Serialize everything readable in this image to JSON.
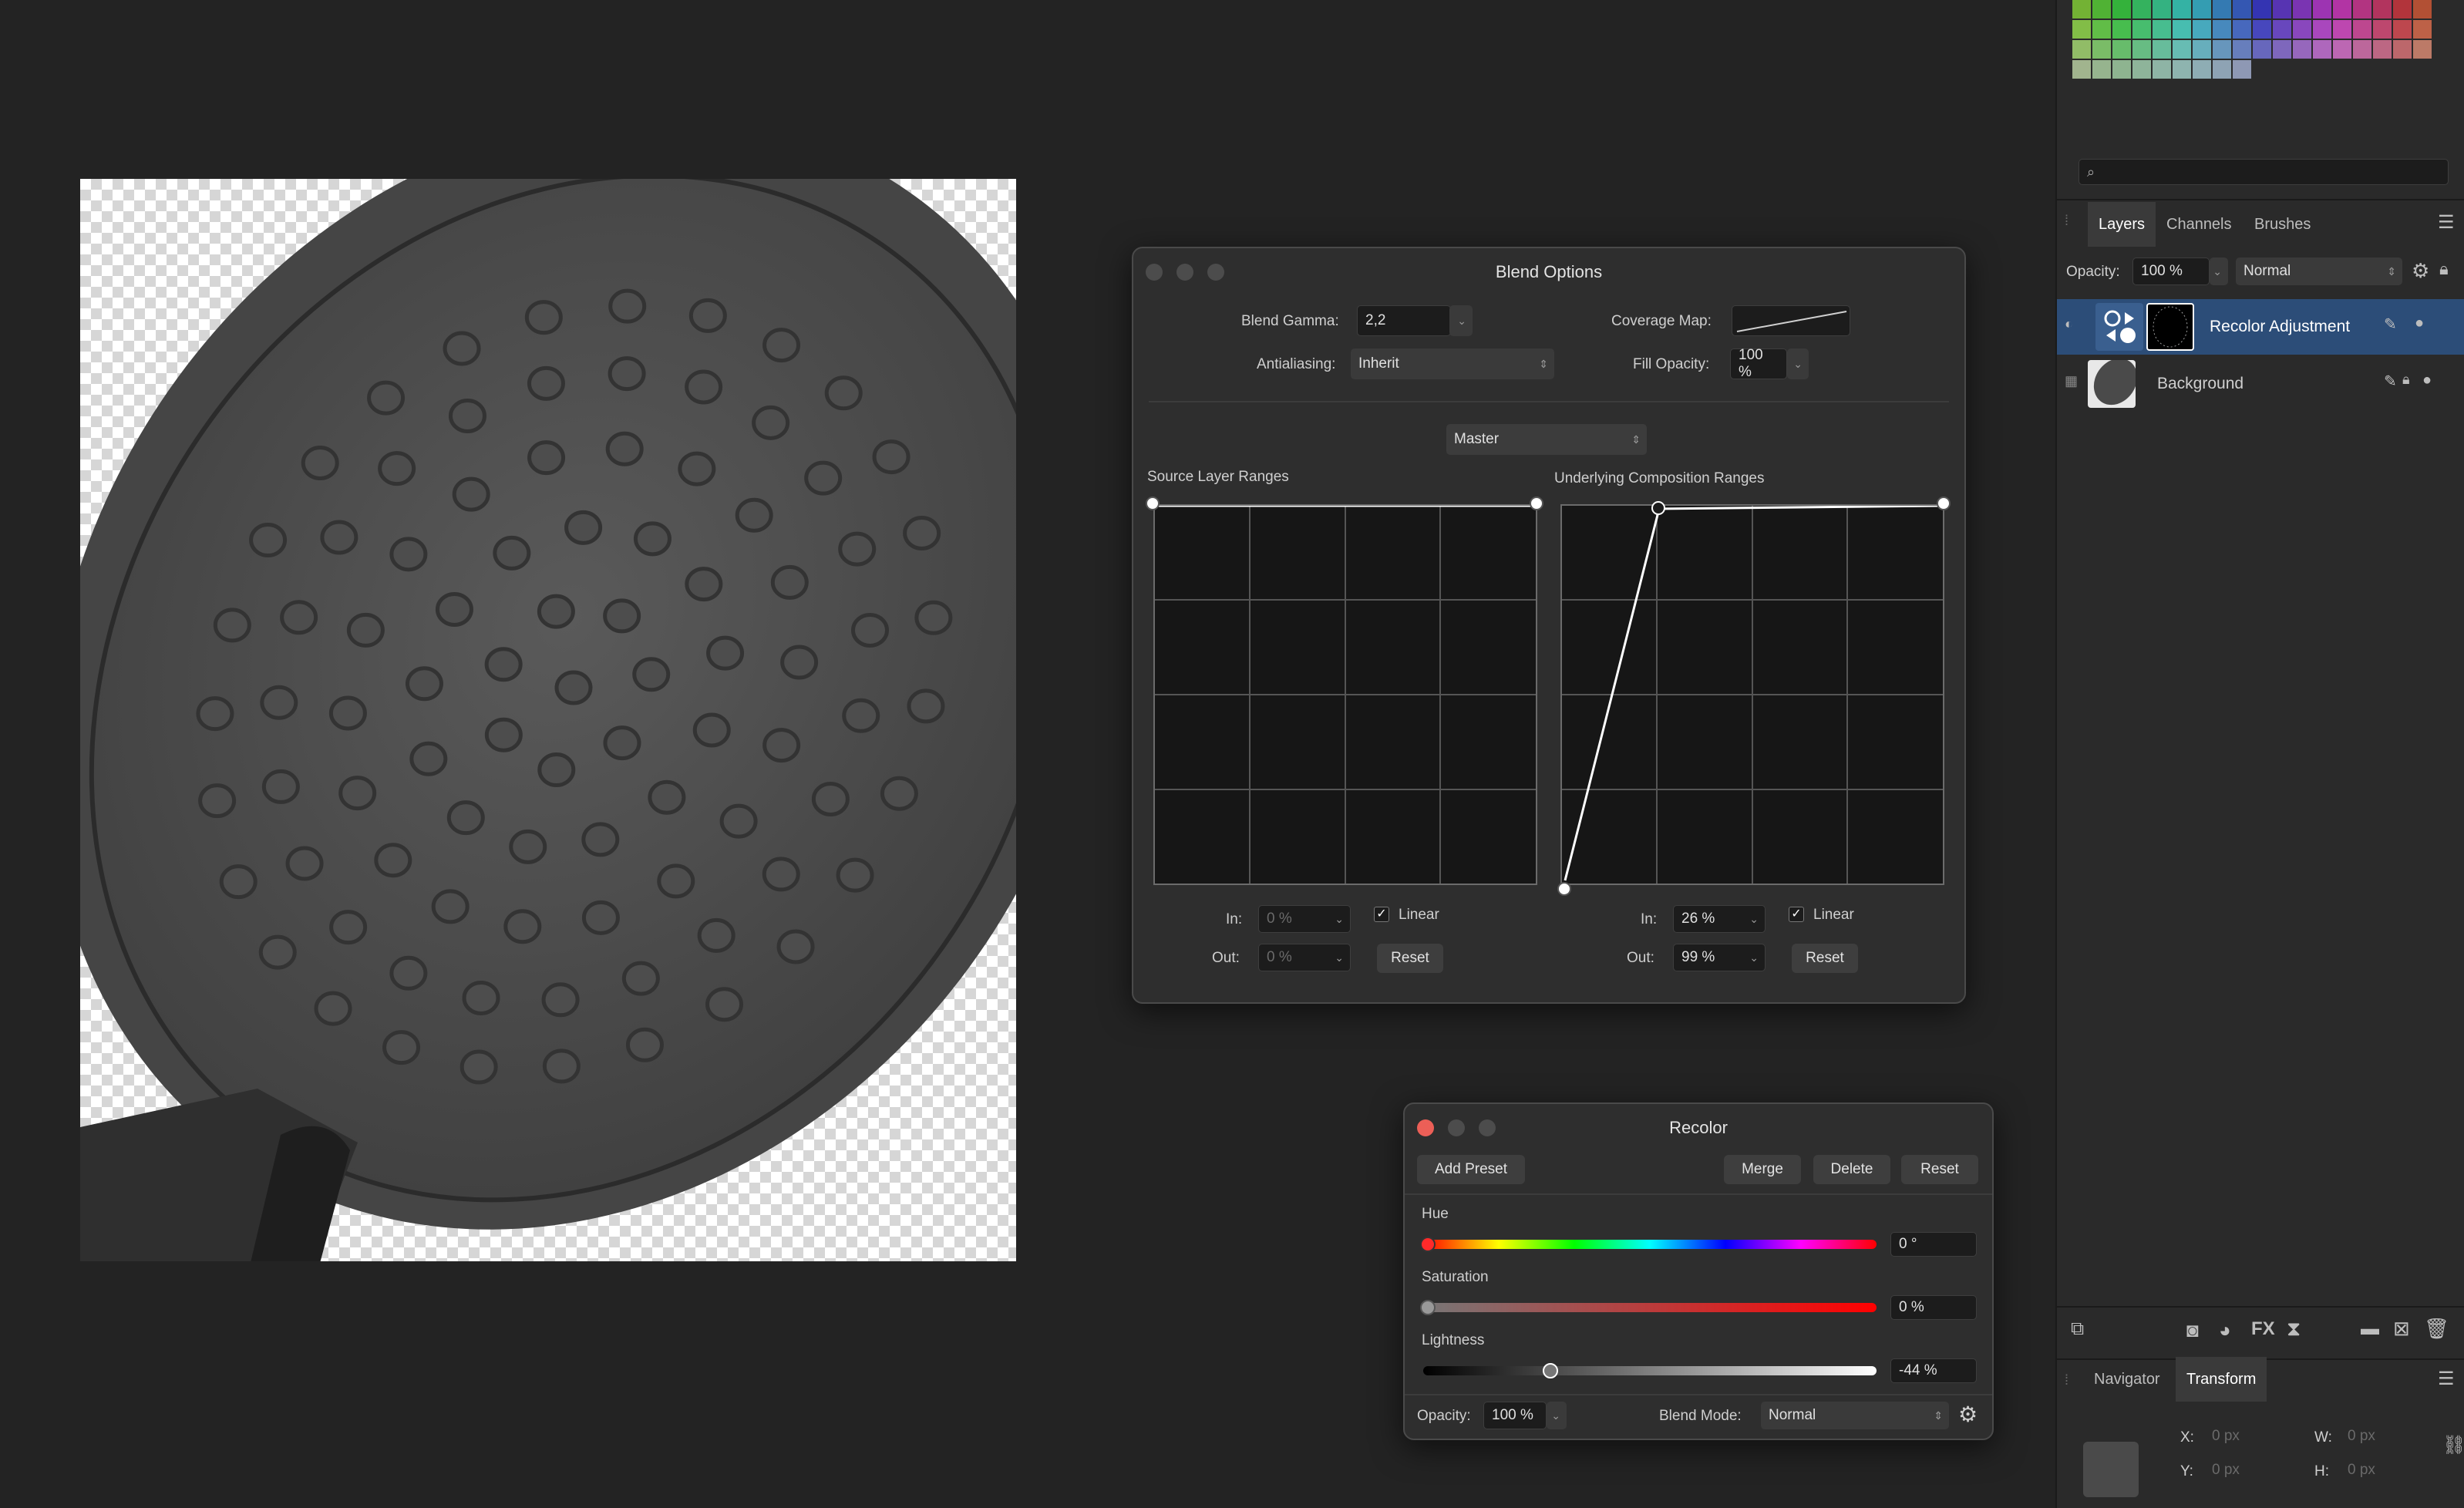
{
  "blend_options": {
    "title": "Blend Options",
    "blend_gamma_label": "Blend Gamma:",
    "blend_gamma_value": "2,2",
    "antialiasing_label": "Antialiasing:",
    "antialiasing_value": "Inherit",
    "coverage_map_label": "Coverage Map:",
    "fill_opacity_label": "Fill Opacity:",
    "fill_opacity_value": "100 %",
    "channel_value": "Master",
    "source_ranges_label": "Source Layer Ranges",
    "underlying_ranges_label": "Underlying Composition Ranges",
    "source": {
      "in_label": "In:",
      "in_value": "0 %",
      "out_label": "Out:",
      "out_value": "0 %",
      "linear_label": "Linear",
      "linear_checked": true,
      "reset_label": "Reset"
    },
    "underlying": {
      "in_label": "In:",
      "in_value": "26 %",
      "out_label": "Out:",
      "out_value": "99 %",
      "linear_label": "Linear",
      "linear_checked": true,
      "reset_label": "Reset"
    }
  },
  "recolor": {
    "title": "Recolor",
    "add_preset_label": "Add Preset",
    "merge_label": "Merge",
    "delete_label": "Delete",
    "reset_label": "Reset",
    "hue_label": "Hue",
    "hue_value": "0 °",
    "hue_fraction": 0,
    "saturation_label": "Saturation",
    "saturation_value": "0 %",
    "saturation_fraction": 0,
    "lightness_label": "Lightness",
    "lightness_value": "-44 %",
    "lightness_fraction": 0.28,
    "opacity_label": "Opacity:",
    "opacity_value": "100 %",
    "blend_mode_label": "Blend Mode:",
    "blend_mode_value": "Normal"
  },
  "layers_panel": {
    "tabs": [
      "Layers",
      "Channels",
      "Brushes"
    ],
    "active_tab": "Layers",
    "opacity_label": "Opacity:",
    "opacity_value": "100 %",
    "blend_mode_value": "Normal",
    "layers": [
      {
        "name": "Recolor Adjustment",
        "selected": true
      },
      {
        "name": "Background",
        "selected": false
      }
    ]
  },
  "transform_panel": {
    "tabs": [
      "Navigator",
      "Transform"
    ],
    "active_tab": "Transform",
    "x_label": "X:",
    "x_value": "0 px",
    "y_label": "Y:",
    "y_value": "0 px",
    "w_label": "W:",
    "w_value": "0 px",
    "h_label": "H:",
    "h_value": "0 px"
  },
  "colors": {
    "accent_selected": "#2c4d78",
    "close_red": "#ec5f57"
  }
}
